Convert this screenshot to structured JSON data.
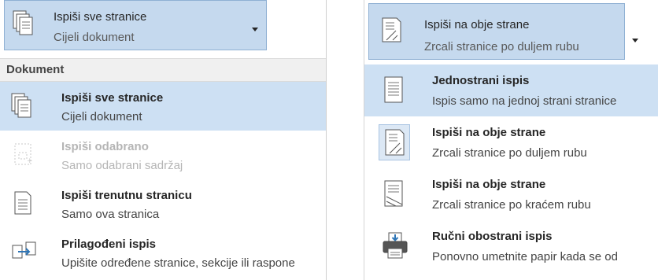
{
  "left": {
    "dropdown": {
      "title": "Ispiši sve stranice",
      "subtitle": "Cijeli dokument",
      "icon": "pages-stack-icon"
    },
    "section_header": "Dokument",
    "items": [
      {
        "title": "Ispiši sve stranice",
        "subtitle": "Cijeli dokument",
        "icon": "pages-stack-icon",
        "state": "selected"
      },
      {
        "title": "Ispiši odabrano",
        "subtitle": "Samo odabrani sadržaj",
        "icon": "selection-page-icon",
        "state": "disabled"
      },
      {
        "title": "Ispiši trenutnu stranicu",
        "subtitle": "Samo ova stranica",
        "icon": "single-page-icon",
        "state": "normal"
      },
      {
        "title": "Prilagođeni ispis",
        "subtitle": "Upišite određene stranice, sekcije ili raspone",
        "icon": "custom-pages-icon",
        "state": "normal"
      }
    ]
  },
  "right": {
    "dropdown": {
      "title": "Ispiši na obje strane",
      "subtitle": "Zrcali stranice po duljem rubu",
      "icon": "duplex-long-edge-icon"
    },
    "items": [
      {
        "title": "Jednostrani ispis",
        "subtitle": "Ispis samo na jednoj strani stranice",
        "icon": "one-sided-icon",
        "state": "selected"
      },
      {
        "title": "Ispiši na obje strane",
        "subtitle": "Zrcali stranice po duljem rubu",
        "icon": "duplex-long-edge-icon",
        "state": "current"
      },
      {
        "title": "Ispiši na obje strane",
        "subtitle": "Zrcali stranice po kraćem rubu",
        "icon": "duplex-short-edge-icon",
        "state": "normal"
      },
      {
        "title": "Ručni obostrani ispis",
        "subtitle": "Ponovno umetnite papir kada se od",
        "icon": "manual-duplex-printer-icon",
        "state": "normal"
      }
    ]
  },
  "colors": {
    "highlight": "#cde0f3",
    "dropdown_bg": "#c5d9ee",
    "accent": "#2e75b6"
  }
}
